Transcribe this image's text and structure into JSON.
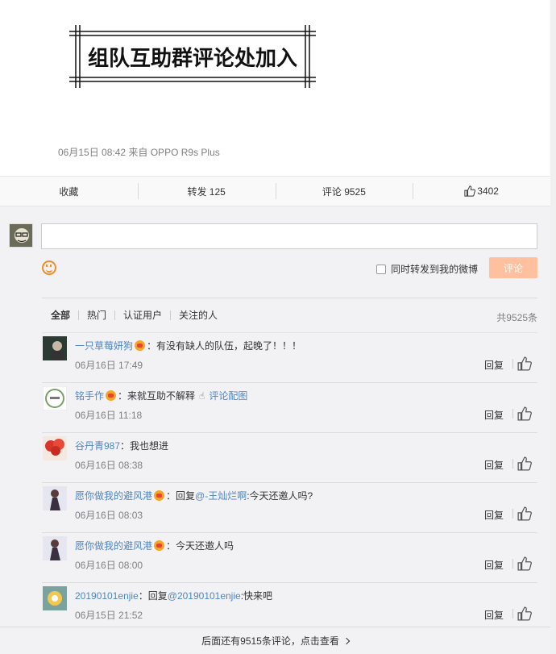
{
  "post": {
    "banner_text": "组队互助群评论处加入",
    "meta": "06月15日 08:42 来自 OPPO R9s Plus"
  },
  "actions": {
    "favorite": "收藏",
    "repost": "转发 125",
    "comment": "评论 9525",
    "like": "3402"
  },
  "composer": {
    "forward_label": "同时转发到我的微博",
    "submit_label": "评论"
  },
  "filters": {
    "tabs": [
      "全部",
      "热门",
      "认证用户",
      "关注的人"
    ],
    "total": "共9525条"
  },
  "comments": [
    {
      "user": "一只草莓妍狗",
      "badge": true,
      "text": "：有没有缺人的队伍，起晚了！！！",
      "time": "06月16日 17:49",
      "reply": "回复"
    },
    {
      "user": "铭手作",
      "badge": true,
      "text": "：来就互助不解释",
      "link": "评论配图",
      "time": "06月16日 11:18",
      "reply": "回复"
    },
    {
      "user": "谷丹青987",
      "badge": false,
      "text": "：我也想进",
      "time": "06月16日 08:38",
      "reply": "回复"
    },
    {
      "user": "愿你做我的避风港",
      "badge": true,
      "text_pre": "：回复",
      "mention": "@-王灿烂啊",
      "text": ":今天还邀人吗?",
      "time": "06月16日 08:03",
      "reply": "回复"
    },
    {
      "user": "愿你做我的避风港",
      "badge": true,
      "text": "：今天还邀人吗",
      "time": "06月16日 08:00",
      "reply": "回复"
    },
    {
      "user": "20190101enjie",
      "badge": false,
      "text_pre": "：回复",
      "mention": "@20190101enjie",
      "text": ":快来吧",
      "time": "06月15日 21:52",
      "reply": "回复"
    }
  ],
  "more": {
    "label": "后面还有9515条评论，点击查看"
  },
  "colors": {
    "username": "#4d86c4",
    "submit_bg": "#ffc09f",
    "accent_orange": "#f28c2a"
  }
}
